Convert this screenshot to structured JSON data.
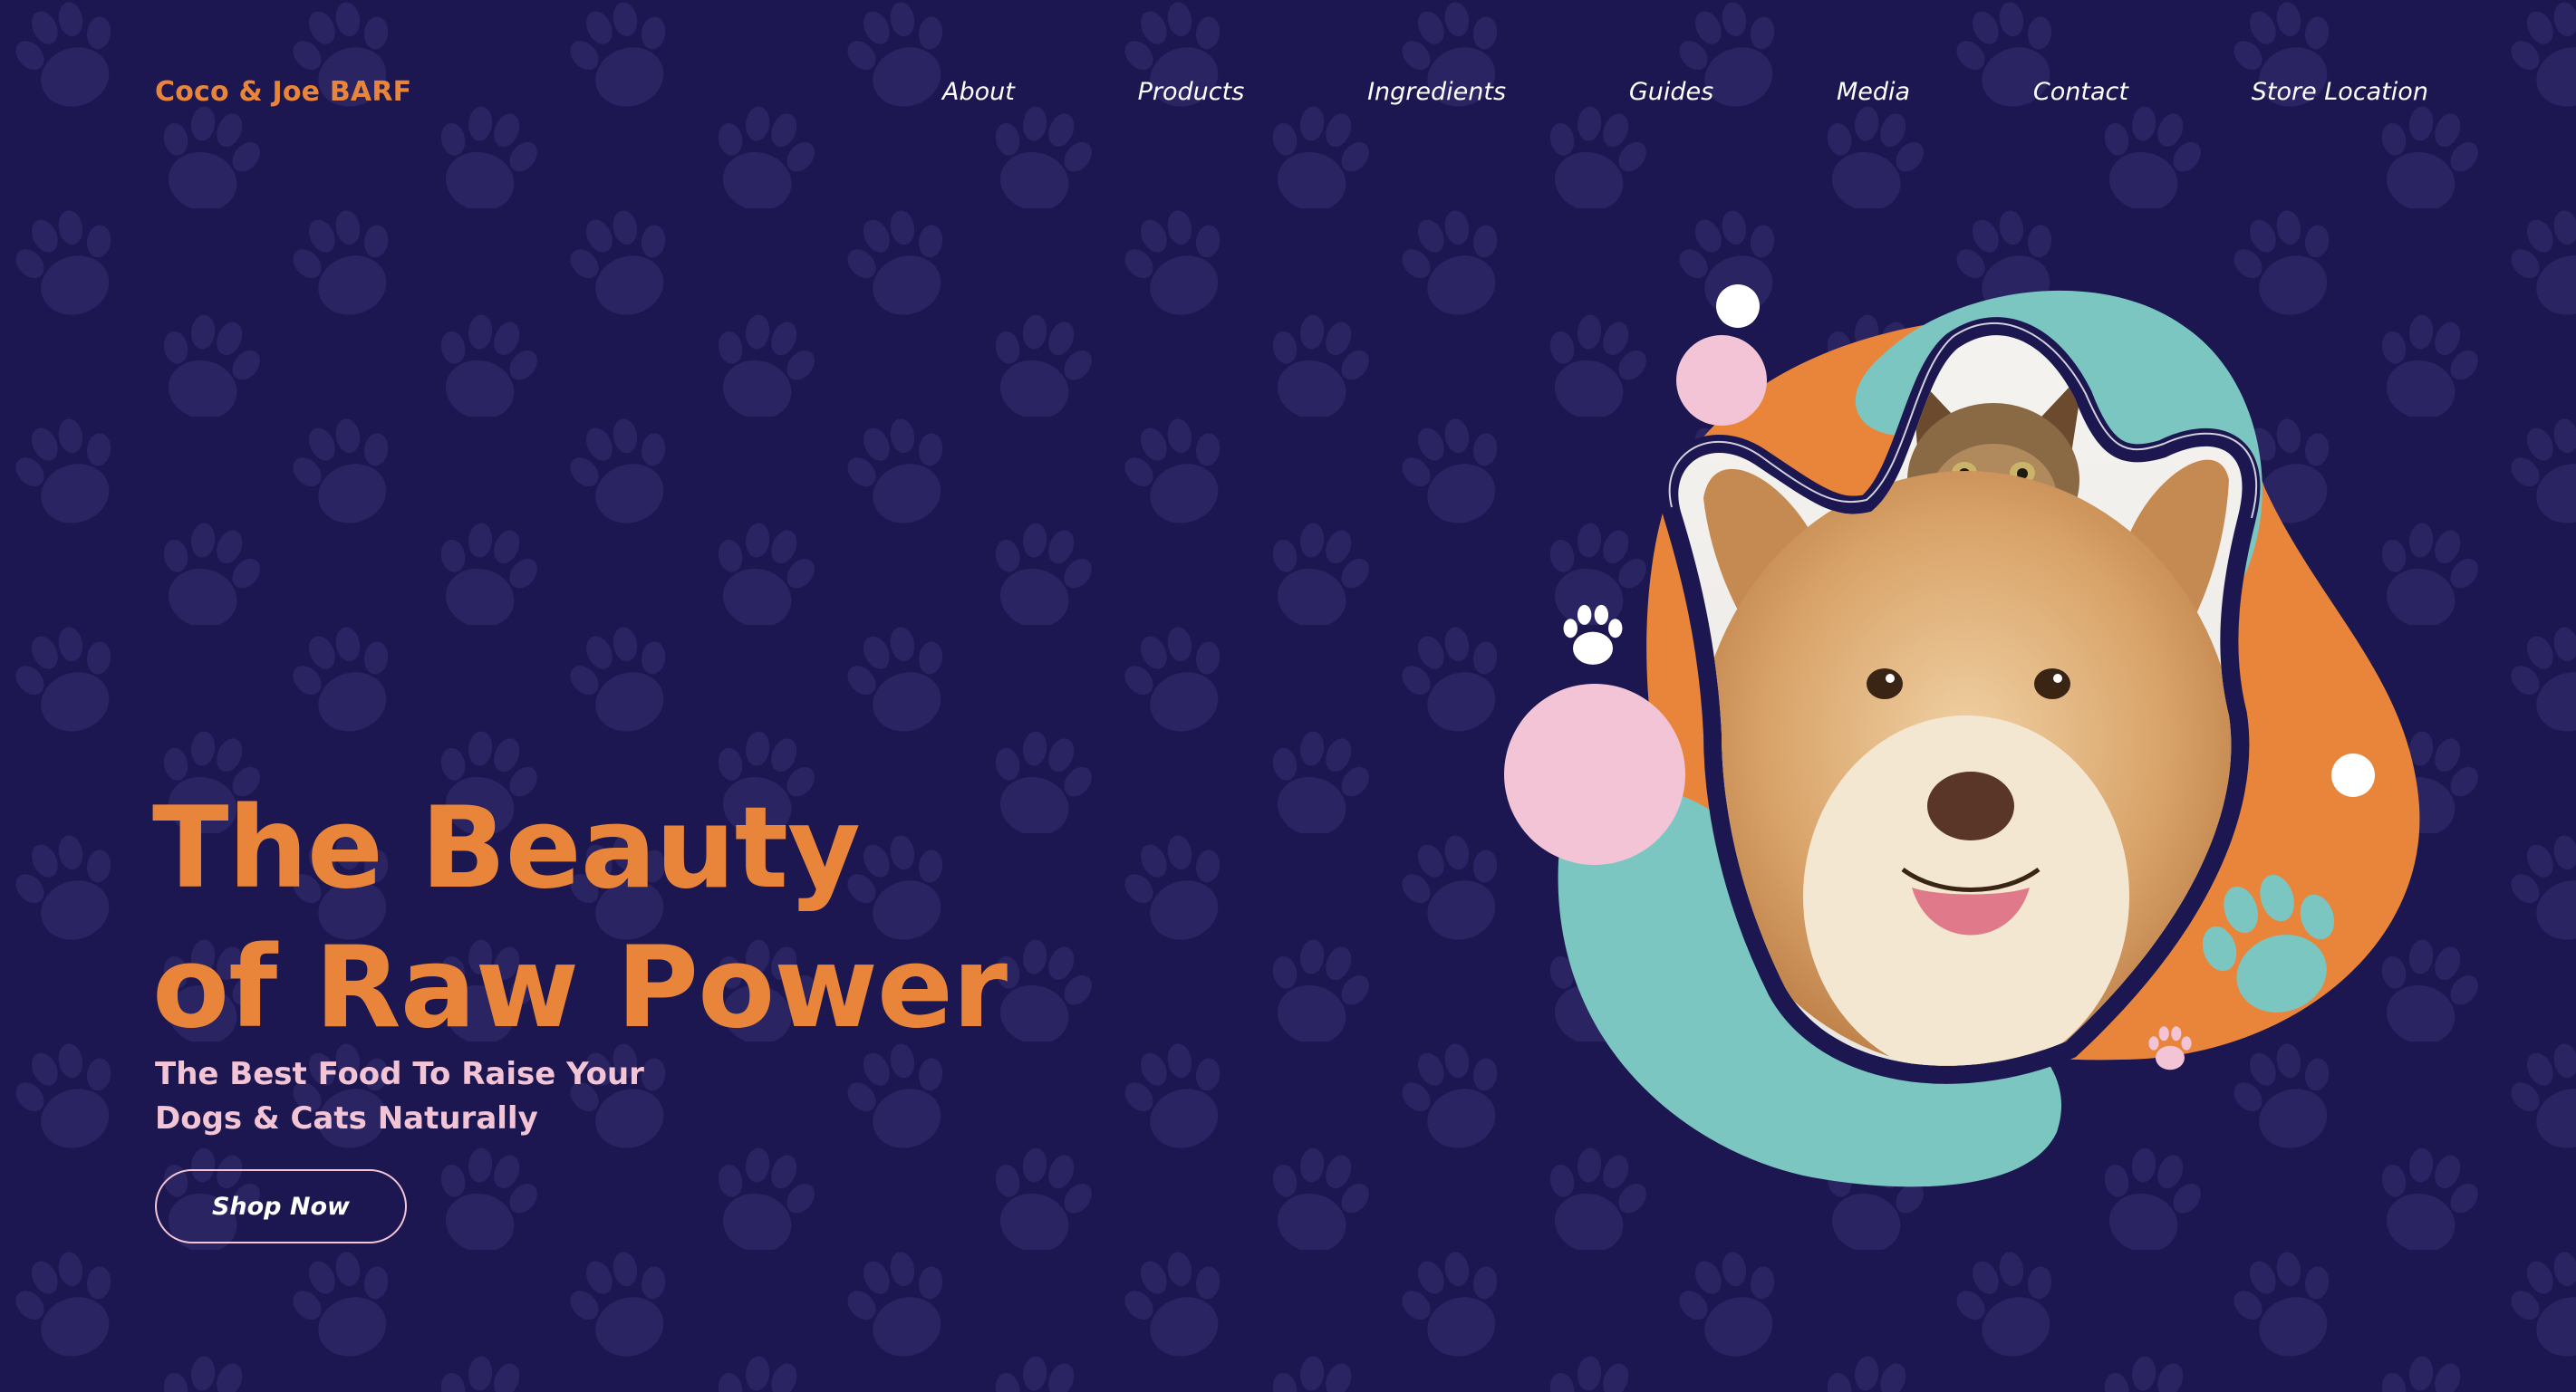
{
  "brand": {
    "name": "Coco & Joe BARF"
  },
  "nav": {
    "items": [
      {
        "label": "About"
      },
      {
        "label": "Products"
      },
      {
        "label": "Ingredients"
      },
      {
        "label": "Guides"
      },
      {
        "label": "Media"
      },
      {
        "label": "Contact"
      },
      {
        "label": "Store Location"
      }
    ]
  },
  "hero": {
    "title_lines": [
      "The Beauty",
      "of Raw Power"
    ],
    "subtitle_lines": [
      "The Best Food To Raise Your",
      "Dogs & Cats Naturally"
    ],
    "cta_label": "Shop Now",
    "image_subject": "dog-with-kitten-on-head"
  },
  "colors": {
    "background": "#1c1750",
    "paw_pattern": "#2a2463",
    "accent_orange": "#e8853a",
    "accent_pink": "#f2c4d6",
    "accent_teal": "#7cc6c2",
    "text_white": "#ffffff"
  },
  "icons": [
    "paw-icon"
  ]
}
